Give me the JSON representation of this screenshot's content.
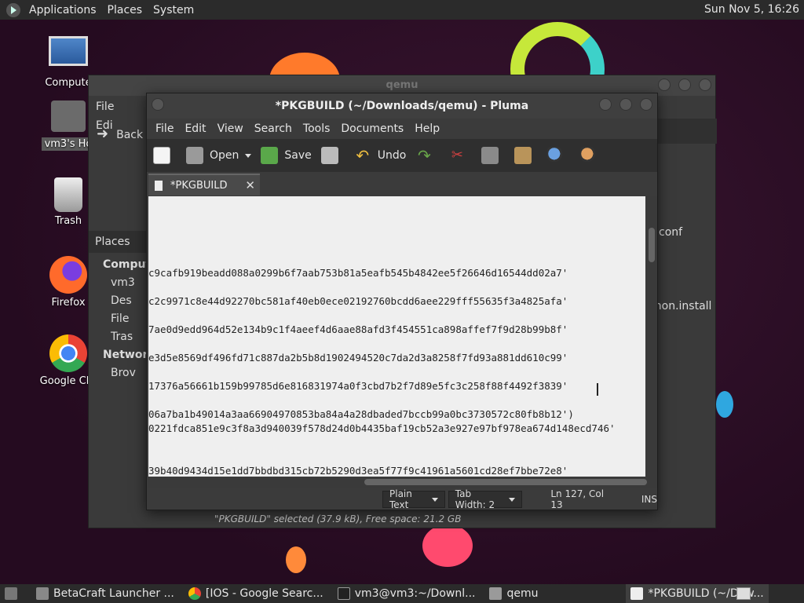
{
  "top_panel": {
    "applications": "Applications",
    "places": "Places",
    "system": "System",
    "clock": "Sun Nov 5, 16:26"
  },
  "desktop": {
    "icons": [
      {
        "label": "Compute"
      },
      {
        "label": "vm3's Ho"
      },
      {
        "label": "Trash"
      },
      {
        "label": "Firefox"
      },
      {
        "label": "Google Chr"
      }
    ]
  },
  "caja": {
    "title": "qemu",
    "menu_file": "File",
    "menu_edit": "Edi",
    "back": "Back",
    "places": "Places",
    "side": {
      "computer": "Compute",
      "vm3": "vm3",
      "desktop": "Des",
      "file": "File",
      "trash": "Tras",
      "network": "Network",
      "browse": "Brov"
    },
    "right_file_1": "conf",
    "right_file_2": "mon.install",
    "status": "\"PKGBUILD\" selected (37.9 kB), Free space: 21.2 GB"
  },
  "pluma": {
    "title": "*PKGBUILD (~/Downloads/qemu) - Pluma",
    "menu": {
      "file": "File",
      "edit": "Edit",
      "view": "View",
      "search": "Search",
      "tools": "Tools",
      "documents": "Documents",
      "help": "Help"
    },
    "toolbar": {
      "open": "Open",
      "save": "Save",
      "undo": "Undo"
    },
    "tab": "*PKGBUILD",
    "lines": [
      "c9cafb919beadd088a0299b6f7aab753b81a5eafb545b4842ee5f26646d16544dd02a7'",
      "c2c9971c8e44d92270bc581af40eb0ece02192760bcdd6aee229fff55635f3a4825afa'",
      "7ae0d9edd964d52e134b9c1f4aeef4d6aae88afd3f454551ca898affef7f9d28b99b8f'",
      "e3d5e8569df496fd71c887da2b5b8d1902494520c7da2d3a8258f7fd93a881dd610c99'",
      "17376a56661b159b99785d6e816831974a0f3cbd7b2f7d89e5fc3c258f88f4492f3839'",
      "06a7ba1b49014a3aa66904970853ba84a4a28dbaded7bccb99a0bc3730572c80fb8b12')",
      "0221fdca851e9c3f8a3d940039f578d24d0b4435baf19cb52a3e927e97bf978ea674d148ecd746'",
      "39b40d9434d15e1dd7bbdbd315cb72b5290d3ea5f77f9c41961a5601cd28ef7bbe72e8'"
    ],
    "status": {
      "syntax": "Plain Text",
      "tab_width": "Tab Width:  2",
      "position": "Ln 127, Col 13",
      "mode": "INS"
    }
  },
  "taskbar": {
    "items": [
      {
        "label": "BetaCraft Launcher ..."
      },
      {
        "label": "[IOS - Google Searc..."
      },
      {
        "label": "vm3@vm3:~/Downl..."
      },
      {
        "label": "qemu"
      },
      {
        "label": "*PKGBUILD (~/Dow..."
      }
    ]
  },
  "colors": {
    "wallpaper": "#2a0f24",
    "editor_bg": "#efefef",
    "panel": "#2b2b2b"
  }
}
